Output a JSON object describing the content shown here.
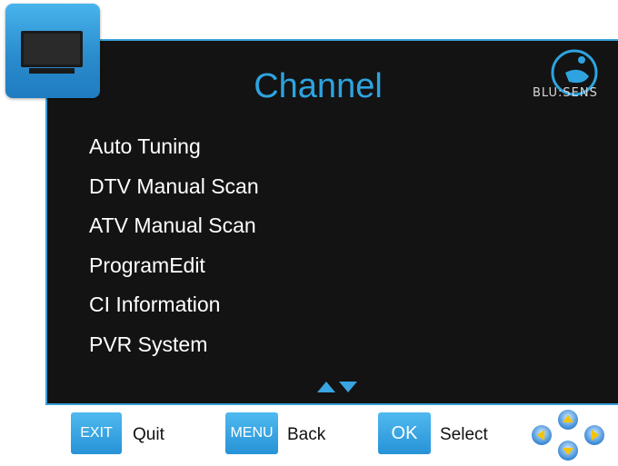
{
  "menu": {
    "title": "Channel",
    "items": [
      {
        "label": "Auto Tuning"
      },
      {
        "label": "DTV Manual Scan"
      },
      {
        "label": "ATV Manual Scan"
      },
      {
        "label": "ProgramEdit"
      },
      {
        "label": "CI Information"
      },
      {
        "label": "PVR System"
      }
    ]
  },
  "brand": {
    "name": "BLU:SENS"
  },
  "footer": {
    "exit_key": "EXIT",
    "exit_label": "Quit",
    "menu_key": "MENU",
    "menu_label": "Back",
    "ok_key": "OK",
    "ok_label": "Select"
  },
  "colors": {
    "accent": "#2ea3e0",
    "panel": "#131313",
    "border": "#3a9fd8",
    "key": "#2792d6",
    "arrow": "#f5c400"
  },
  "icons": [
    "tv-icon",
    "brand-logo",
    "scroll-up-down-icon",
    "dpad-icon"
  ]
}
